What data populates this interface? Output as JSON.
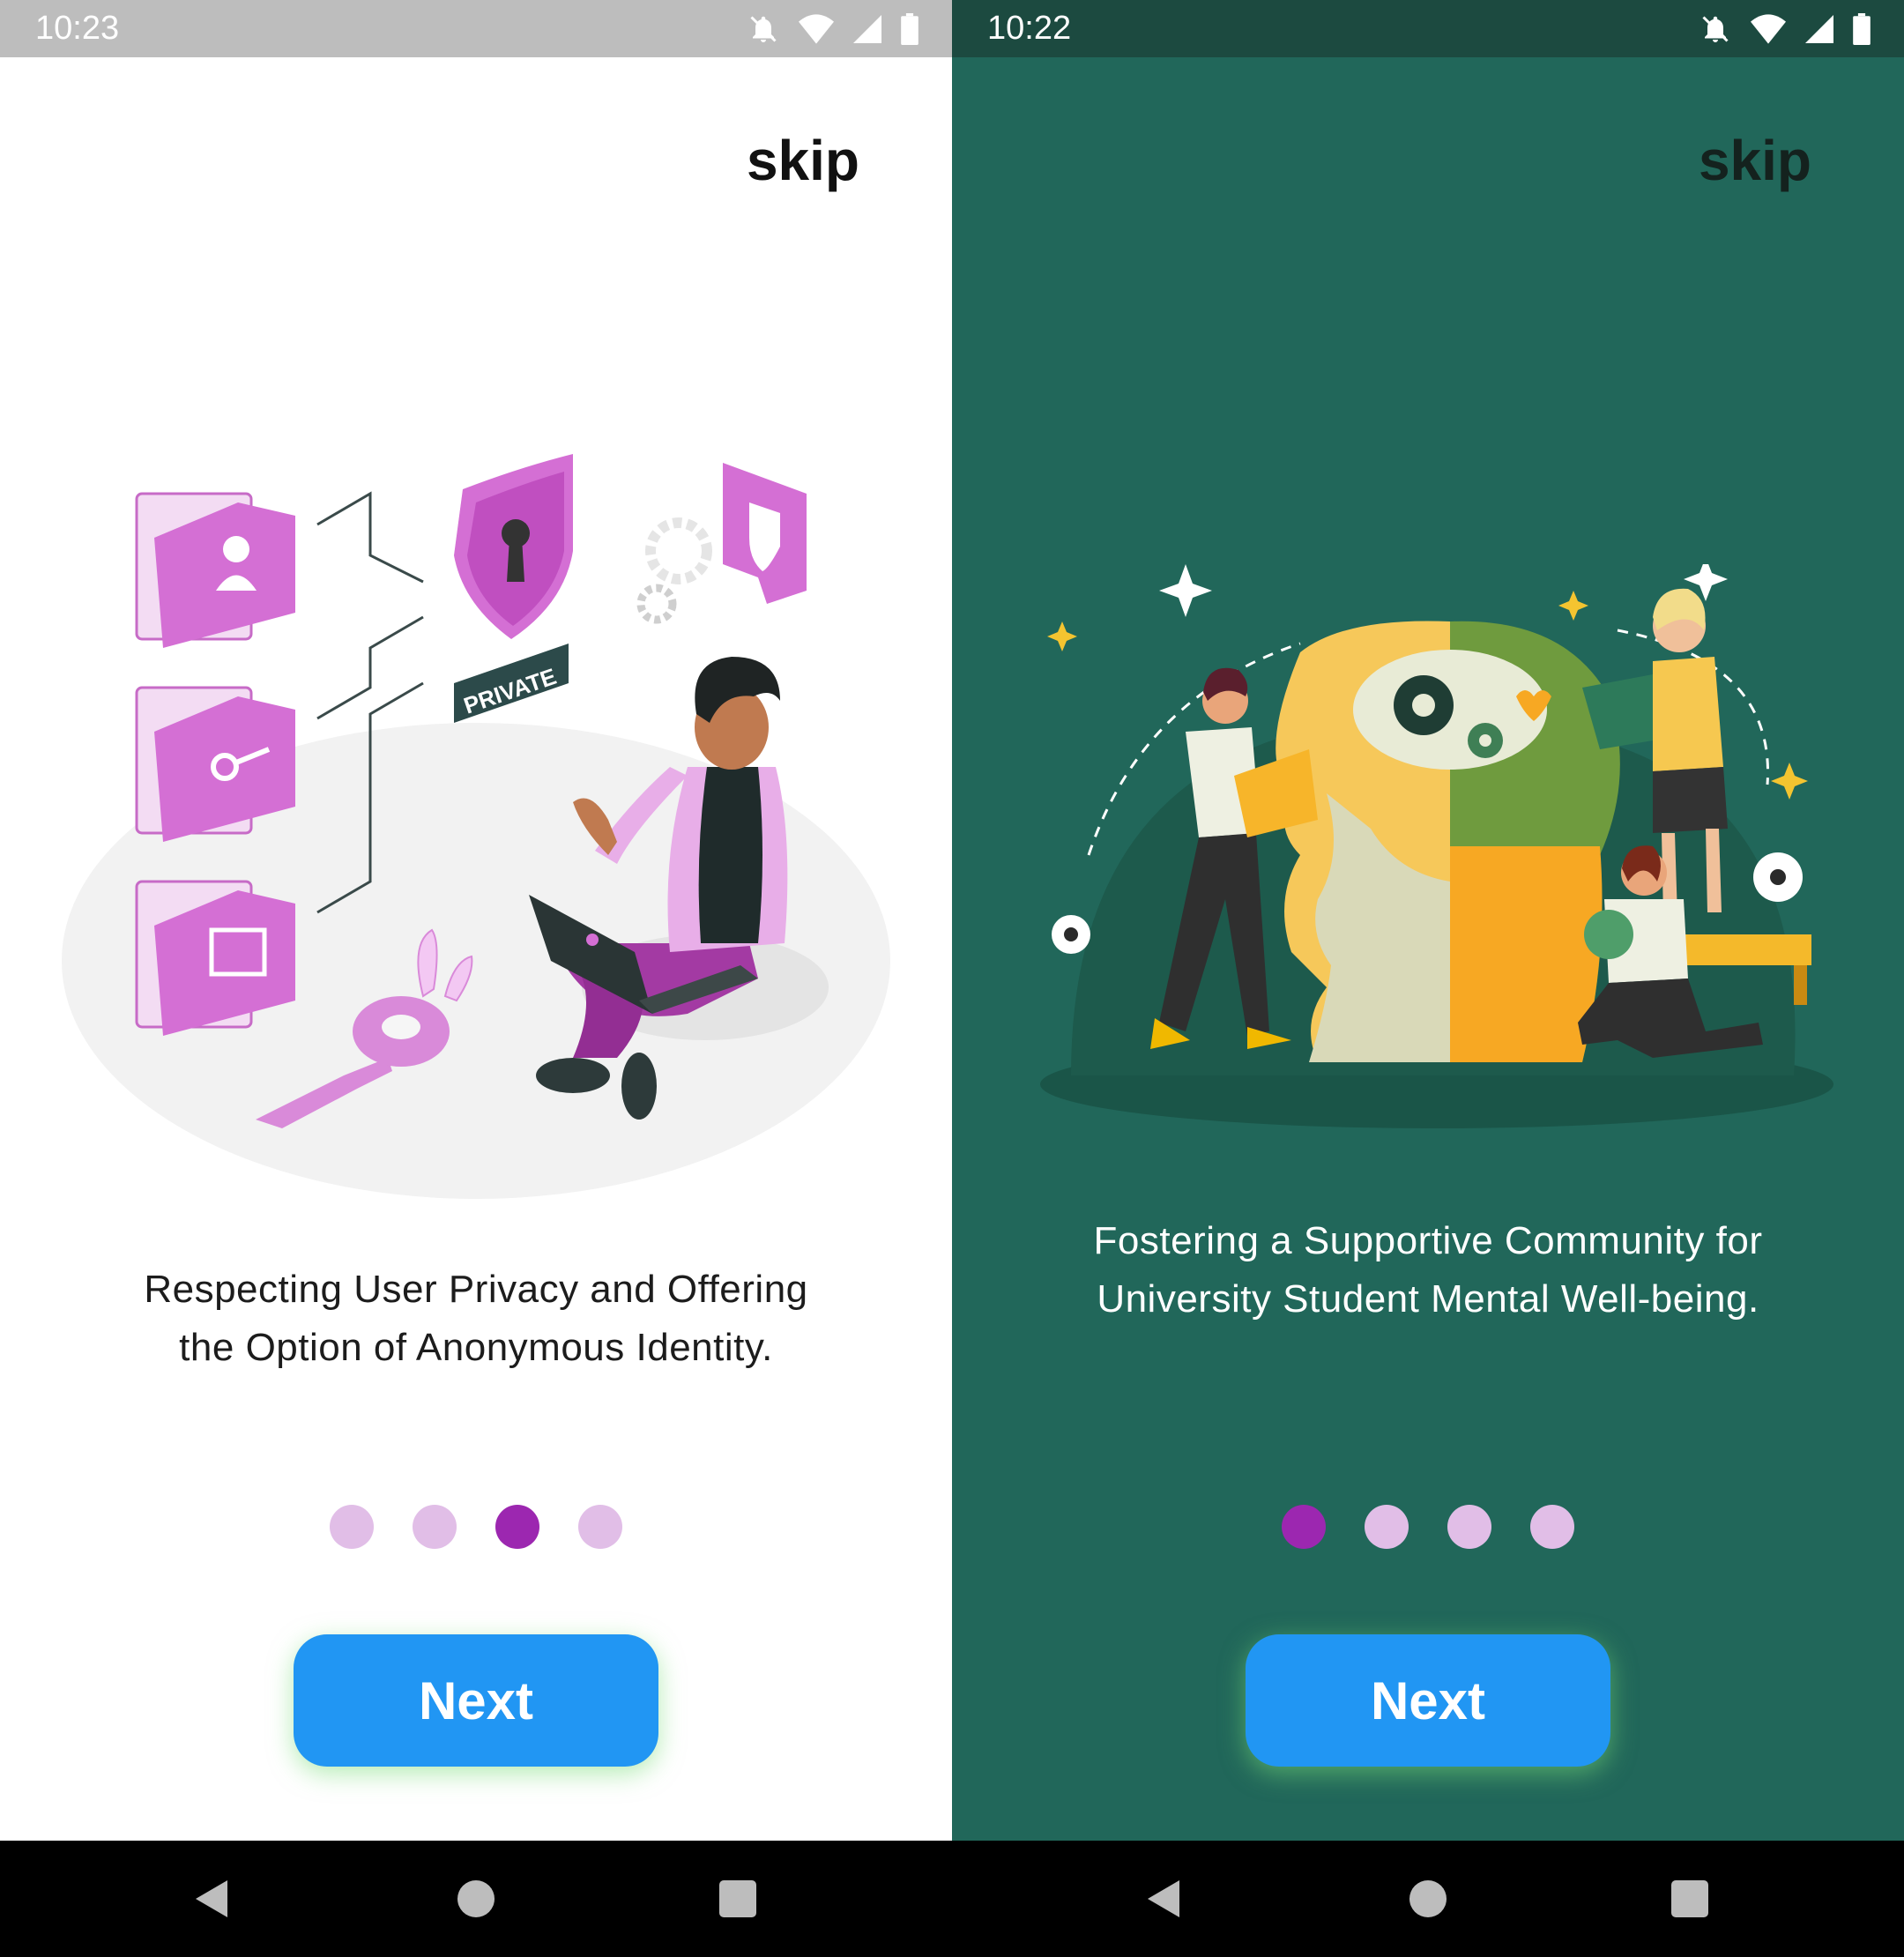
{
  "screens": [
    {
      "status_bar": {
        "time": "10:23"
      },
      "skip_label": "skip",
      "caption": {
        "line1": "Respecting User Privacy and Offering",
        "line2": "the Option of Anonymous Identity."
      },
      "illustration": {
        "badge_text": "PRIVATE"
      },
      "pagination": {
        "total": 4,
        "active_index": 2
      },
      "next_label": "Next"
    },
    {
      "status_bar": {
        "time": "10:22"
      },
      "skip_label": "skip",
      "caption": {
        "line1": "Fostering a Supportive Community for",
        "line2": "University Student Mental Well-being."
      },
      "pagination": {
        "total": 4,
        "active_index": 0
      },
      "next_label": "Next"
    }
  ],
  "colors": {
    "accent_button": "#2196f3",
    "dot_active": "#9c27b0",
    "dot_inactive": "#e1bee7",
    "right_background": "#21675a",
    "left_background": "#ffffff"
  },
  "icons": [
    "notifications-off-icon",
    "wifi-icon",
    "cellular-signal-icon",
    "battery-icon",
    "nav-back-icon",
    "nav-home-icon",
    "nav-recents-icon"
  ]
}
